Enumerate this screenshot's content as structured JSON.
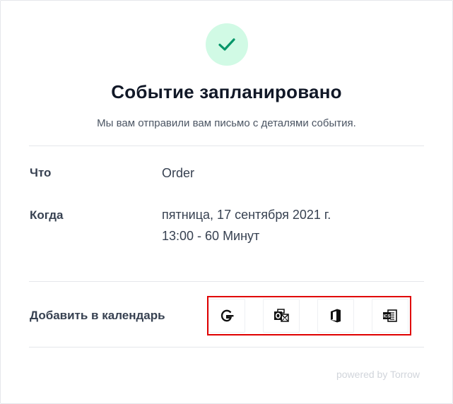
{
  "header": {
    "title": "Событие запланировано",
    "subtitle": "Мы вам отправили вам письмо с деталями события.",
    "status_icon": "checkmark-icon"
  },
  "details": {
    "what_label": "Что",
    "what_value": "Order",
    "when_label": "Когда",
    "when_date": "пятница, 17 сентября 2021 г.",
    "when_time": "13:00 - 60 Минут"
  },
  "calendar": {
    "label": "Добавить в календарь",
    "buttons": [
      {
        "icon": "google-calendar-icon"
      },
      {
        "icon": "outlook-icon"
      },
      {
        "icon": "office365-icon"
      },
      {
        "icon": "ics-file-icon"
      }
    ]
  },
  "footer": {
    "powered_by": "powered by Torrow"
  },
  "colors": {
    "success_bg": "#d1fae5",
    "success_check": "#059669",
    "highlight": "#e00000"
  }
}
